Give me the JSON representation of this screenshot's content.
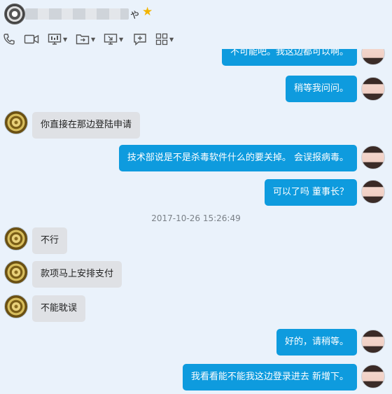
{
  "header": {
    "contact_suffix": "や",
    "star_glyph": "★"
  },
  "toolbar": {
    "items": [
      "phone-icon",
      "video-icon",
      "screen-share-icon",
      "file-transfer-icon",
      "remote-desktop-icon",
      "add-app-icon",
      "more-apps-icon"
    ]
  },
  "messages": [
    {
      "side": "right",
      "text": "不可能吧。我这边都可以啊。"
    },
    {
      "side": "right",
      "text": "稍等我问问。"
    },
    {
      "side": "left",
      "text": "你直接在那边登陆申请"
    },
    {
      "side": "right",
      "text": "技术部说是不是杀毒软件什么的要关掉。 会误报病毒。"
    },
    {
      "side": "right",
      "text": "可以了吗  董事长？"
    },
    {
      "side": "left",
      "text": "不行"
    },
    {
      "side": "left",
      "text": "款项马上安排支付"
    },
    {
      "side": "left",
      "text": "不能耽误"
    },
    {
      "side": "right",
      "text": "好的，请稍等。"
    },
    {
      "side": "right",
      "text": "我看看能不能我这边登录进去 新增下。"
    }
  ],
  "timestamp": "2017-10-26 15:26:49",
  "colors": {
    "background": "#eaf2fb",
    "outgoing_bubble": "#0e9bde",
    "incoming_bubble": "#dfe1e5",
    "timestamp_text": "#7a8087"
  }
}
